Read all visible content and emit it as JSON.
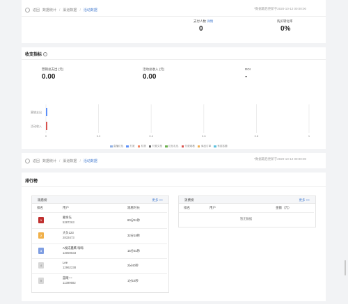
{
  "top": {
    "back": "返回",
    "crumbs": [
      "数据统计",
      "渠道数据",
      "活动数据"
    ],
    "updated": "*数据最后更新于2020-10-12 00:00:00"
  },
  "metrics_top": {
    "payers_label": "支付人数",
    "payers_link": "详情",
    "payers_value": "0",
    "conversion_label": "购买转化率",
    "conversion_value": "0%"
  },
  "finance": {
    "title": "收支指标",
    "cost_label": "营销总支出 (元)",
    "cost_value": "0.00",
    "income_label": "活动总收入 (元)",
    "income_value": "0.00",
    "roi_label": "ROI",
    "roi_value": "-"
  },
  "chart_data": {
    "type": "bar",
    "orientation": "horizontal",
    "stacked": true,
    "categories": [
      "营销支出",
      "活动收入"
    ],
    "x_ticks": [
      "0",
      "0.2",
      "0.4",
      "0.6",
      "0.8",
      "1"
    ],
    "xlim": [
      0,
      1
    ],
    "series": [
      {
        "name": "直播红包",
        "color": "#91b0e3",
        "values": [
          0,
          0
        ]
      },
      {
        "name": "打赏",
        "color": "#5b8ff9",
        "values": [
          0,
          0
        ]
      },
      {
        "name": "礼物",
        "color": "#f0825f",
        "values": [
          0,
          0
        ]
      },
      {
        "name": "付费文档",
        "color": "#666666",
        "values": [
          0,
          0
        ]
      },
      {
        "name": "红包礼包",
        "color": "#6ab04c",
        "values": [
          0,
          0
        ]
      },
      {
        "name": "付费观看",
        "color": "#d9534f",
        "values": [
          0,
          0
        ]
      },
      {
        "name": "商品订单",
        "color": "#f0ad4e",
        "values": [
          0,
          0
        ]
      },
      {
        "name": "有奖答题",
        "color": "#5bc0de",
        "values": [
          0,
          0
        ]
      }
    ],
    "grid": true,
    "legend": "bottom"
  },
  "bottom": {
    "back": "返回",
    "crumbs": [
      "数据统计",
      "渠道数据",
      "活动数据"
    ],
    "updated": "*数据最后更新于2020-10-12 00:00:00"
  },
  "ranking": {
    "title": "排行榜",
    "watch": {
      "title": "观看榜",
      "more": "更多 >>",
      "headers": [
        "排名",
        "用户",
        "观看时长"
      ],
      "rows": [
        {
          "rank": "1",
          "name": "蒙余先",
          "id": "5387263",
          "value": "60分51秒",
          "medal_color": "#c0302f"
        },
        {
          "rank": "2",
          "name": "大头123",
          "id": "2833473",
          "value": "32分18秒",
          "medal_color": "#f0b04a"
        },
        {
          "rank": "3",
          "name": "A视成鑫鹰 嗨嗨",
          "id": "13059833",
          "value": "15分31秒",
          "medal_color": "#7f9ee2"
        },
        {
          "rank": "4",
          "name": "Lee",
          "id": "12962238",
          "value": "2分40秒",
          "medal_color": "#d8d8d8"
        },
        {
          "rank": "5",
          "name": "蓝眼~~",
          "id": "11399682",
          "value": "1分15秒",
          "medal_color": "#d8d8d8"
        }
      ]
    },
    "spend": {
      "title": "消费榜",
      "more": "更多 >>",
      "headers": [
        "排名",
        "用户",
        "金额（元）"
      ],
      "empty": "暂无数据"
    }
  }
}
